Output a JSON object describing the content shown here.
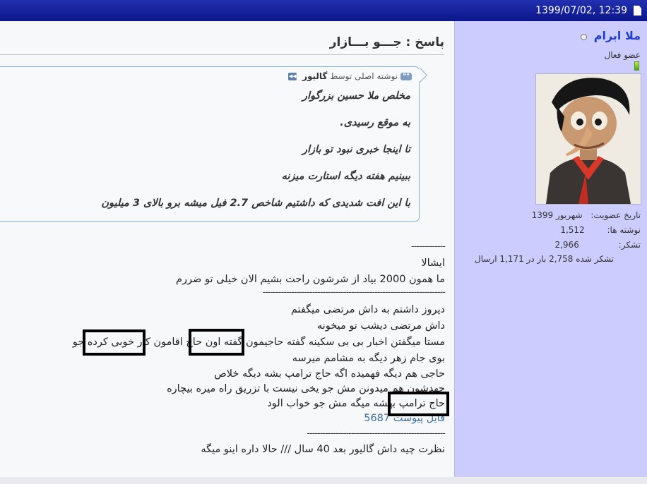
{
  "topbar": {
    "datetime": "1399/07/02, 12:39"
  },
  "user": {
    "name": "ملا ابرام",
    "rank": "عضو فعال",
    "join_label": "تاریخ عضویت:",
    "join_value": "شهریور 1399",
    "posts_label": "نوشته ها:",
    "posts_value": "1,512",
    "thanks_label": "تشکر:",
    "thanks_value": "2,966",
    "thanked": "تشکر شده 2,758 بار در 1,171 ارسال"
  },
  "post": {
    "title": "پاسخ : جـــو بـــازار",
    "quote": {
      "prefix": "نوشته اصلی توسط",
      "author": "گالیور",
      "lines": [
        "مخلص ملا حسین بزرگوار",
        "به موقع رسیدی.",
        "تا اینجا خبری نبود تو بازار",
        "ببینیم هفته دیگه استارت میزنه",
        "با این افت شدیدی که داشتیم شاخص 2.7 فیل میشه برو بالای 3 میلیون"
      ]
    },
    "body": {
      "sep1": "-------------",
      "line1": "ایشالا",
      "line2": "ما همون 2000 بیاد از شرشون راحت بشیم الان خیلی تو ضررم",
      "sep2": "----------------------------------------------------------------------",
      "line3": "دیروز داشتم به داش مرتضی میگفتم",
      "line4": "داش مرتضی دیشب تو میخونه",
      "line5": "مستا میگفتن اخبار بی بی سکینه گفته حاجیمون گفته اون حاج اقامون کار خوبی کرده جو",
      "line6": "بوی جام زهر دیگه به مشامم میرسه",
      "line7": "حاجی هم دیگه فهمیده اگه حاج ترامپ بشه دیگه خلاص",
      "line8": "جهدشون هم میدونن مش جو یخی نیست با تزریق راه میره بیچاره",
      "line9": "حاج ترامپ بهشه میگه مش جو خواب الود",
      "attachment": "فایل پیوست 5687",
      "sep3": "-----------------------------------------------------",
      "line10": "نظرت چیه داش گالیور بعد 40 سال /// حالا داره اینو میگه"
    }
  },
  "colors": {
    "topbar": "#0b168a",
    "sidebar": "#ccccff",
    "username": "#2240d0",
    "quote_border": "#8db3d4",
    "link": "#3e6ea0"
  }
}
